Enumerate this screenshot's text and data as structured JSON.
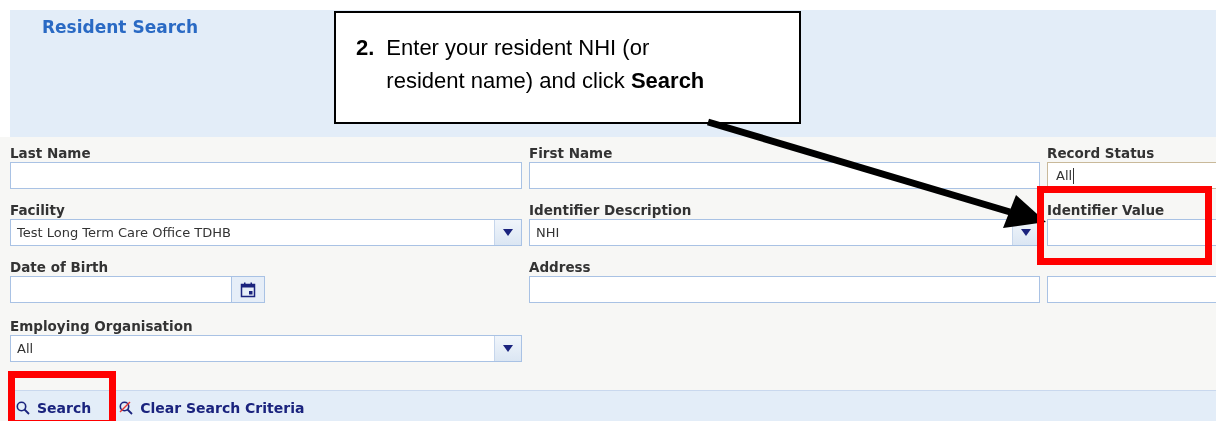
{
  "header": {
    "title": "Resident Search"
  },
  "callout": {
    "step": "2.",
    "text": "Enter your resident NHI (or resident name) and click **Search**"
  },
  "fields": [
    {
      "label": "Last Name",
      "kind": "text"
    },
    {
      "label": "First Name",
      "kind": "text"
    },
    {
      "label": "Record Status",
      "kind": "readonly",
      "value": "All"
    },
    {
      "label": "Facility",
      "kind": "select",
      "value": "Test Long Term Care Office TDHB"
    },
    {
      "label": "Identifier Description",
      "kind": "select",
      "value": "NHI"
    },
    {
      "label": "Identifier Value",
      "kind": "text"
    },
    {
      "label": "Date of Birth",
      "kind": "date"
    },
    {
      "label": "Address",
      "kind": "text"
    },
    {
      "kind": "text"
    },
    {
      "label": "Employing Organisation",
      "kind": "select",
      "value": "All"
    }
  ],
  "toolbar": [
    {
      "label": "Search",
      "kind": "search"
    },
    {
      "label": "Clear Search Criteria",
      "kind": "clear"
    }
  ]
}
